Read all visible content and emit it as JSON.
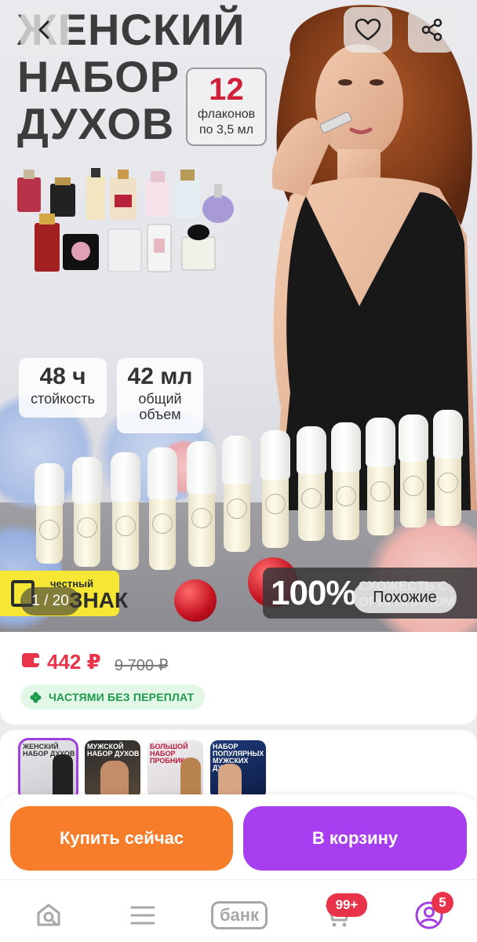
{
  "hero": {
    "title_lines": [
      "ЖЕНСКИЙ",
      "НАБОР",
      "ДУХОВ"
    ],
    "badge_number": "12",
    "badge_sub1": "флаконов",
    "badge_sub2": "по 3,5 мл",
    "stat1_value": "48 ч",
    "stat1_label": "стойкость",
    "stat2_value": "42 мл",
    "stat2_label1": "общий",
    "stat2_label2": "объем",
    "chestny_line1": "честный",
    "chestny_line2": "ЗНАК",
    "similarity_pct": "100%",
    "similarity_text": "СХОЖЕСТЬ С ОРИГИНАЛОМ",
    "counter": "1 / 20",
    "similar_button": "Похожие"
  },
  "top_buttons": {
    "back_icon": "chevron-left-icon",
    "favorite_icon": "heart-icon",
    "share_icon": "share-icon"
  },
  "price": {
    "current": "442 ₽",
    "old": "9 700 ₽",
    "installment": "ЧАСТЯМИ БЕЗ ПЕРЕПЛАТ",
    "accent": "#e8334b",
    "installment_color": "#1e9b4a"
  },
  "thumbnails": [
    {
      "title": "ЖЕНСКИЙ НАБОР ДУХОВ",
      "active": true
    },
    {
      "title": "МУЖСКОЙ НАБОР ДУХОВ",
      "active": false
    },
    {
      "title": "БОЛЬШОЙ НАБОР ПРОБНИКОВ",
      "active": false
    },
    {
      "title": "НАБОР ПОПУЛЯРНЫХ МУЖСКИХ ДУХОВ",
      "active": false
    }
  ],
  "actions": {
    "buy_now": "Купить сейчас",
    "add_to_cart": "В корзину",
    "buy_color": "#f87d2a",
    "cart_color": "#a73ef0"
  },
  "bottom_nav": {
    "items": [
      "home-icon",
      "menu-icon",
      "bank",
      "cart-icon",
      "profile-icon"
    ],
    "bank_label": "банк",
    "cart_badge": "99+",
    "profile_badge": "5"
  }
}
